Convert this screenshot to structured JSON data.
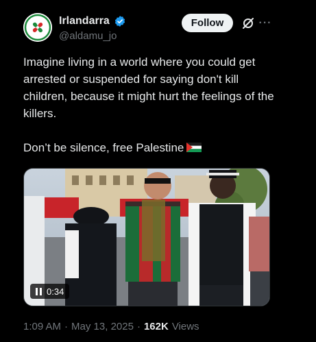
{
  "author": {
    "display_name": "Irlandarra",
    "handle": "@aldamu_jo",
    "verified": true,
    "avatar_icon": "lauburu-avatar-icon"
  },
  "actions": {
    "follow_label": "Follow",
    "grok_icon": "grok-icon",
    "more_icon": "more-icon",
    "more_glyph": "···"
  },
  "tweet": {
    "paragraph_1": "Imagine living in a world where you could get arrested or suspended for saying don't kill children, because it might hurt the feelings of the killers.",
    "paragraph_2": "Don’t be silence, free Palestine",
    "emoji": "palestine-flag-icon"
  },
  "media": {
    "duration": "0:34",
    "playback_icon": "pause-icon"
  },
  "meta": {
    "time": "1:09 AM",
    "separator": "·",
    "date": "May 13, 2025",
    "views_count": "162K",
    "views_label": "Views"
  },
  "colors": {
    "background": "#000000",
    "text_primary": "#e7e9ea",
    "text_secondary": "#71767b",
    "verified_blue": "#1d9bf0",
    "follow_bg": "#eff3f4"
  }
}
